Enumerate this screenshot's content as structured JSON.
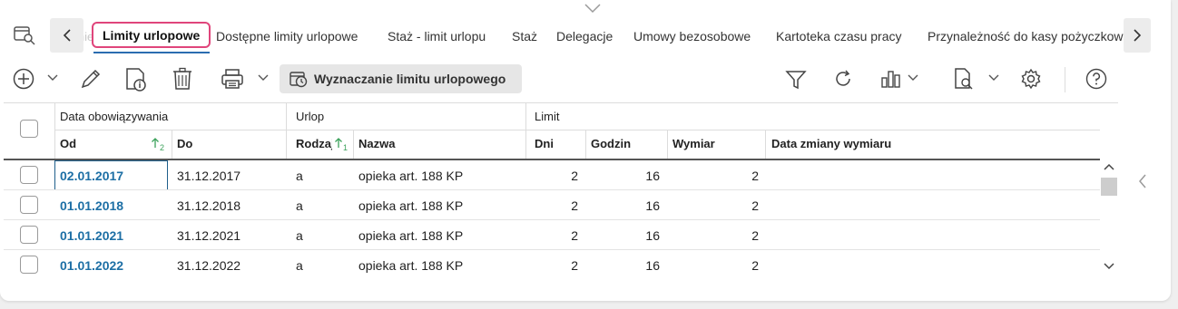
{
  "tabs": {
    "faded_label": "tecznie",
    "active": "Limity urlopowe",
    "items": [
      "Dostępne limity urlopowe",
      "Staż - limit urlopu",
      "Staż",
      "Delegacje",
      "Umowy bezosobowe",
      "Kartoteka czasu pracy"
    ],
    "last": "Przynależność do kasy pożyczkowej"
  },
  "toolbar": {
    "wyznaczanie_label": "Wyznaczanie limitu urlopowego",
    "icons": [
      "add-icon",
      "edit-icon",
      "info-document-icon",
      "delete-icon",
      "print-icon",
      "filter-icon",
      "refresh-icon",
      "chart-icon",
      "preview-icon",
      "settings-icon",
      "help-icon"
    ]
  },
  "grid": {
    "group_headers": {
      "data": "Data obowiązywania",
      "urlop": "Urlop",
      "limit": "Limit"
    },
    "columns": {
      "od": "Od",
      "od_sort": "2",
      "do": "Do",
      "rodzaj": "Rodzaj",
      "rodzaj_sort": "1",
      "nazwa": "Nazwa",
      "dni": "Dni",
      "godzin": "Godzin",
      "wymiar": "Wymiar",
      "data_zmiany": "Data zmiany wymiaru"
    },
    "rows": [
      {
        "od": "02.01.2017",
        "do": "31.12.2017",
        "rodzaj": "a",
        "nazwa": "opieka art. 188 KP",
        "dni": "2",
        "godzin": "16",
        "wymiar": "2",
        "data_zmiany": ""
      },
      {
        "od": "01.01.2018",
        "do": "31.12.2018",
        "rodzaj": "a",
        "nazwa": "opieka art. 188 KP",
        "dni": "2",
        "godzin": "16",
        "wymiar": "2",
        "data_zmiany": ""
      },
      {
        "od": "01.01.2021",
        "do": "31.12.2021",
        "rodzaj": "a",
        "nazwa": "opieka art. 188 KP",
        "dni": "2",
        "godzin": "16",
        "wymiar": "2",
        "data_zmiany": ""
      },
      {
        "od": "01.01.2022",
        "do": "31.12.2022",
        "rodzaj": "a",
        "nazwa": "opieka art. 188 KP",
        "dni": "2",
        "godzin": "16",
        "wymiar": "2",
        "data_zmiany": ""
      }
    ]
  },
  "colors": {
    "active_tab_border": "#e0457b",
    "link_date": "#1d6fa5",
    "sort_arrow": "#3aa15a"
  }
}
